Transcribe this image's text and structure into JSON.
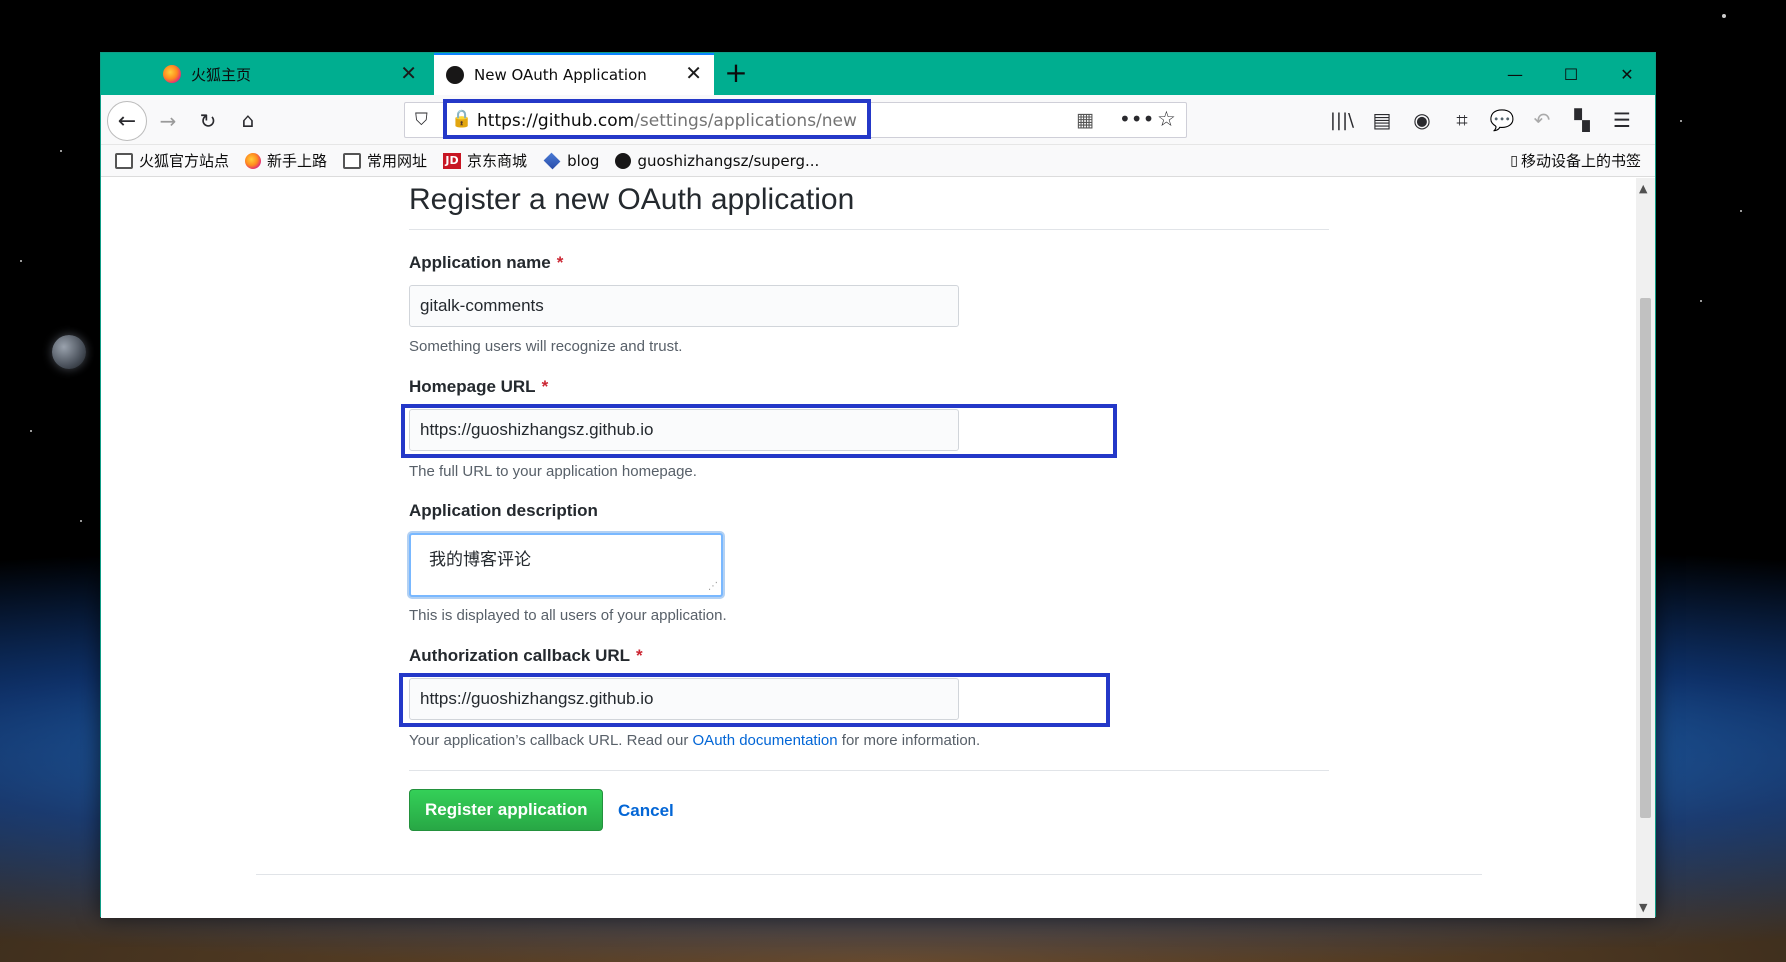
{
  "browser": {
    "tabs": [
      {
        "label": "火狐主页",
        "icon": "firefox-icon"
      },
      {
        "label": "New OAuth Application",
        "icon": "github-icon"
      }
    ],
    "url_domain": "https://github.com",
    "url_path": "/settings/applications/new",
    "bookmarks": [
      {
        "label": "火狐官方站点",
        "icon": "folder-icon"
      },
      {
        "label": "新手上路",
        "icon": "firefox-icon"
      },
      {
        "label": "常用网址",
        "icon": "folder-icon"
      },
      {
        "label": "京东商城",
        "icon": "jd-icon"
      },
      {
        "label": "blog",
        "icon": "layers-icon"
      },
      {
        "label": "guoshizhangsz/superg...",
        "icon": "github-icon"
      }
    ],
    "mobile_bookmarks": "移动设备上的书签",
    "accent_color": "#00ae90"
  },
  "form": {
    "title": "Register a new OAuth application",
    "app_name_label": "Application name",
    "app_name_value": "gitalk-comments",
    "app_name_note": "Something users will recognize and trust.",
    "homepage_label": "Homepage URL",
    "homepage_value": "https://guoshizhangsz.github.io",
    "homepage_note": "The full URL to your application homepage.",
    "description_label": "Application description",
    "description_value": "我的博客评论",
    "description_note": "This is displayed to all users of your application.",
    "callback_label": "Authorization callback URL",
    "callback_value": "https://guoshizhangsz.github.io",
    "callback_note_before": "Your application’s callback URL. Read our",
    "callback_note_link": "OAuth documentation",
    "callback_note_after": "for more information.",
    "required_mark": "*",
    "register_button": "Register application",
    "cancel_link": "Cancel",
    "highlight_color": "#2438c8"
  }
}
